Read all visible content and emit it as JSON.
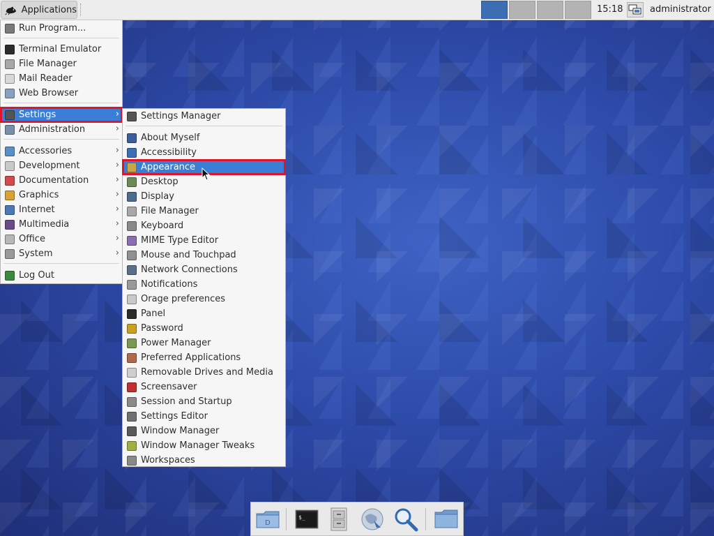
{
  "panel": {
    "applications_label": "Applications",
    "clock": "15:18",
    "user": "administrator",
    "workspaces": 4,
    "active_workspace": 1
  },
  "app_menu": {
    "items": [
      {
        "label": "Run Program...",
        "icon": "run-program-icon",
        "submenu": false
      },
      {
        "label": "Terminal Emulator",
        "icon": "terminal-icon",
        "submenu": false
      },
      {
        "label": "File Manager",
        "icon": "file-manager-icon",
        "submenu": false
      },
      {
        "label": "Mail Reader",
        "icon": "mail-icon",
        "submenu": false
      },
      {
        "label": "Web Browser",
        "icon": "web-browser-icon",
        "submenu": false
      },
      {
        "label": "Settings",
        "icon": "settings-icon",
        "submenu": true,
        "highlighted": true
      },
      {
        "label": "Administration",
        "icon": "administration-icon",
        "submenu": true
      },
      {
        "label": "Accessories",
        "icon": "accessories-icon",
        "submenu": true
      },
      {
        "label": "Development",
        "icon": "development-icon",
        "submenu": true
      },
      {
        "label": "Documentation",
        "icon": "documentation-icon",
        "submenu": true
      },
      {
        "label": "Graphics",
        "icon": "graphics-icon",
        "submenu": true
      },
      {
        "label": "Internet",
        "icon": "internet-icon",
        "submenu": true
      },
      {
        "label": "Multimedia",
        "icon": "multimedia-icon",
        "submenu": true
      },
      {
        "label": "Office",
        "icon": "office-icon",
        "submenu": true
      },
      {
        "label": "System",
        "icon": "system-icon",
        "submenu": true
      },
      {
        "label": "Log Out",
        "icon": "log-out-icon",
        "submenu": false
      }
    ]
  },
  "settings_menu": {
    "items": [
      {
        "label": "Settings Manager",
        "icon": "settings-manager-icon"
      },
      {
        "label": "About Myself",
        "icon": "about-myself-icon"
      },
      {
        "label": "Accessibility",
        "icon": "accessibility-icon"
      },
      {
        "label": "Appearance",
        "icon": "appearance-icon",
        "highlighted": true
      },
      {
        "label": "Desktop",
        "icon": "desktop-icon"
      },
      {
        "label": "Display",
        "icon": "display-icon"
      },
      {
        "label": "File Manager",
        "icon": "file-manager-icon"
      },
      {
        "label": "Keyboard",
        "icon": "keyboard-icon"
      },
      {
        "label": "MIME Type Editor",
        "icon": "mime-type-icon"
      },
      {
        "label": "Mouse and Touchpad",
        "icon": "mouse-icon"
      },
      {
        "label": "Network Connections",
        "icon": "network-icon"
      },
      {
        "label": "Notifications",
        "icon": "notifications-icon"
      },
      {
        "label": "Orage preferences",
        "icon": "orage-icon"
      },
      {
        "label": "Panel",
        "icon": "panel-icon"
      },
      {
        "label": "Password",
        "icon": "password-icon"
      },
      {
        "label": "Power Manager",
        "icon": "power-manager-icon"
      },
      {
        "label": "Preferred Applications",
        "icon": "preferred-applications-icon"
      },
      {
        "label": "Removable Drives and Media",
        "icon": "removable-drives-icon"
      },
      {
        "label": "Screensaver",
        "icon": "screensaver-icon"
      },
      {
        "label": "Session and Startup",
        "icon": "session-startup-icon"
      },
      {
        "label": "Settings Editor",
        "icon": "settings-editor-icon"
      },
      {
        "label": "Window Manager",
        "icon": "window-manager-icon"
      },
      {
        "label": "Window Manager Tweaks",
        "icon": "window-manager-tweaks-icon"
      },
      {
        "label": "Workspaces",
        "icon": "workspaces-icon"
      }
    ]
  },
  "dock": {
    "items": [
      {
        "icon": "home-folder-icon"
      },
      {
        "icon": "terminal-icon"
      },
      {
        "icon": "file-cabinet-icon"
      },
      {
        "icon": "web-browser-icon"
      },
      {
        "icon": "search-icon"
      },
      {
        "icon": "folder-icon"
      }
    ]
  },
  "colors": {
    "highlight": "#3a7ed6",
    "highlight_border": "#e0152b",
    "desktop": "#2d4aa8"
  }
}
